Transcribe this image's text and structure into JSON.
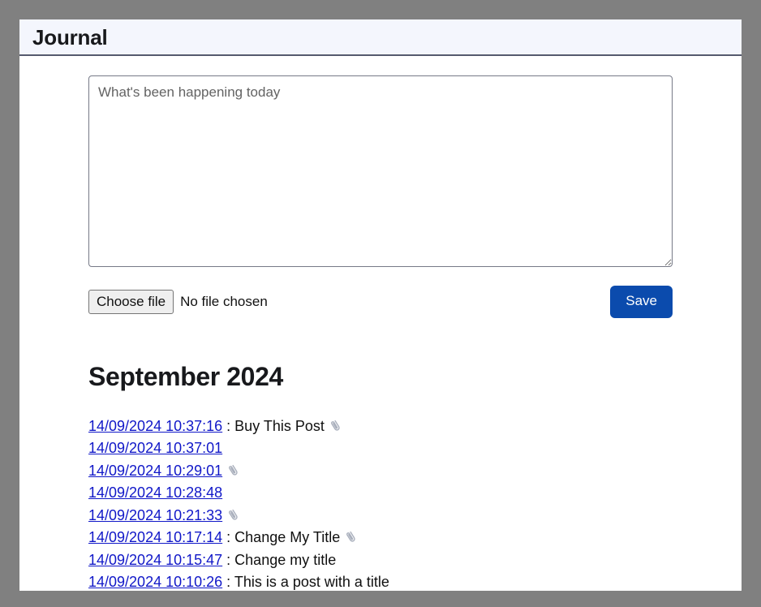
{
  "header": {
    "title": "Journal"
  },
  "composer": {
    "textarea_value": "",
    "textarea_placeholder": "What's been happening today",
    "file_button_label": "Choose file",
    "file_status": "No file chosen",
    "save_label": "Save"
  },
  "month": {
    "heading": "September 2024"
  },
  "entries": [
    {
      "timestamp": "14/09/2024 10:37:16",
      "separator": ":",
      "title": "Buy This Post",
      "attachment": true
    },
    {
      "timestamp": "14/09/2024 10:37:01",
      "separator": "",
      "title": "",
      "attachment": false
    },
    {
      "timestamp": "14/09/2024 10:29:01",
      "separator": "",
      "title": "",
      "attachment": true
    },
    {
      "timestamp": "14/09/2024 10:28:48",
      "separator": "",
      "title": "",
      "attachment": false
    },
    {
      "timestamp": "14/09/2024 10:21:33",
      "separator": "",
      "title": "",
      "attachment": true
    },
    {
      "timestamp": "14/09/2024 10:17:14",
      "separator": ":",
      "title": "Change My Title",
      "attachment": true
    },
    {
      "timestamp": "14/09/2024 10:15:47",
      "separator": ":",
      "title": "Change my title",
      "attachment": false
    },
    {
      "timestamp": "14/09/2024 10:10:26",
      "separator": ":",
      "title": "This is a post with a title",
      "attachment": false
    }
  ],
  "icons": {
    "attachment": "paperclip-icon"
  },
  "colors": {
    "backdrop": "#808080",
    "header_background": "#f4f6fd",
    "header_border": "#555a6e",
    "link": "#1017c8",
    "save_button": "#0b4bad",
    "file_button": "#efefef"
  }
}
